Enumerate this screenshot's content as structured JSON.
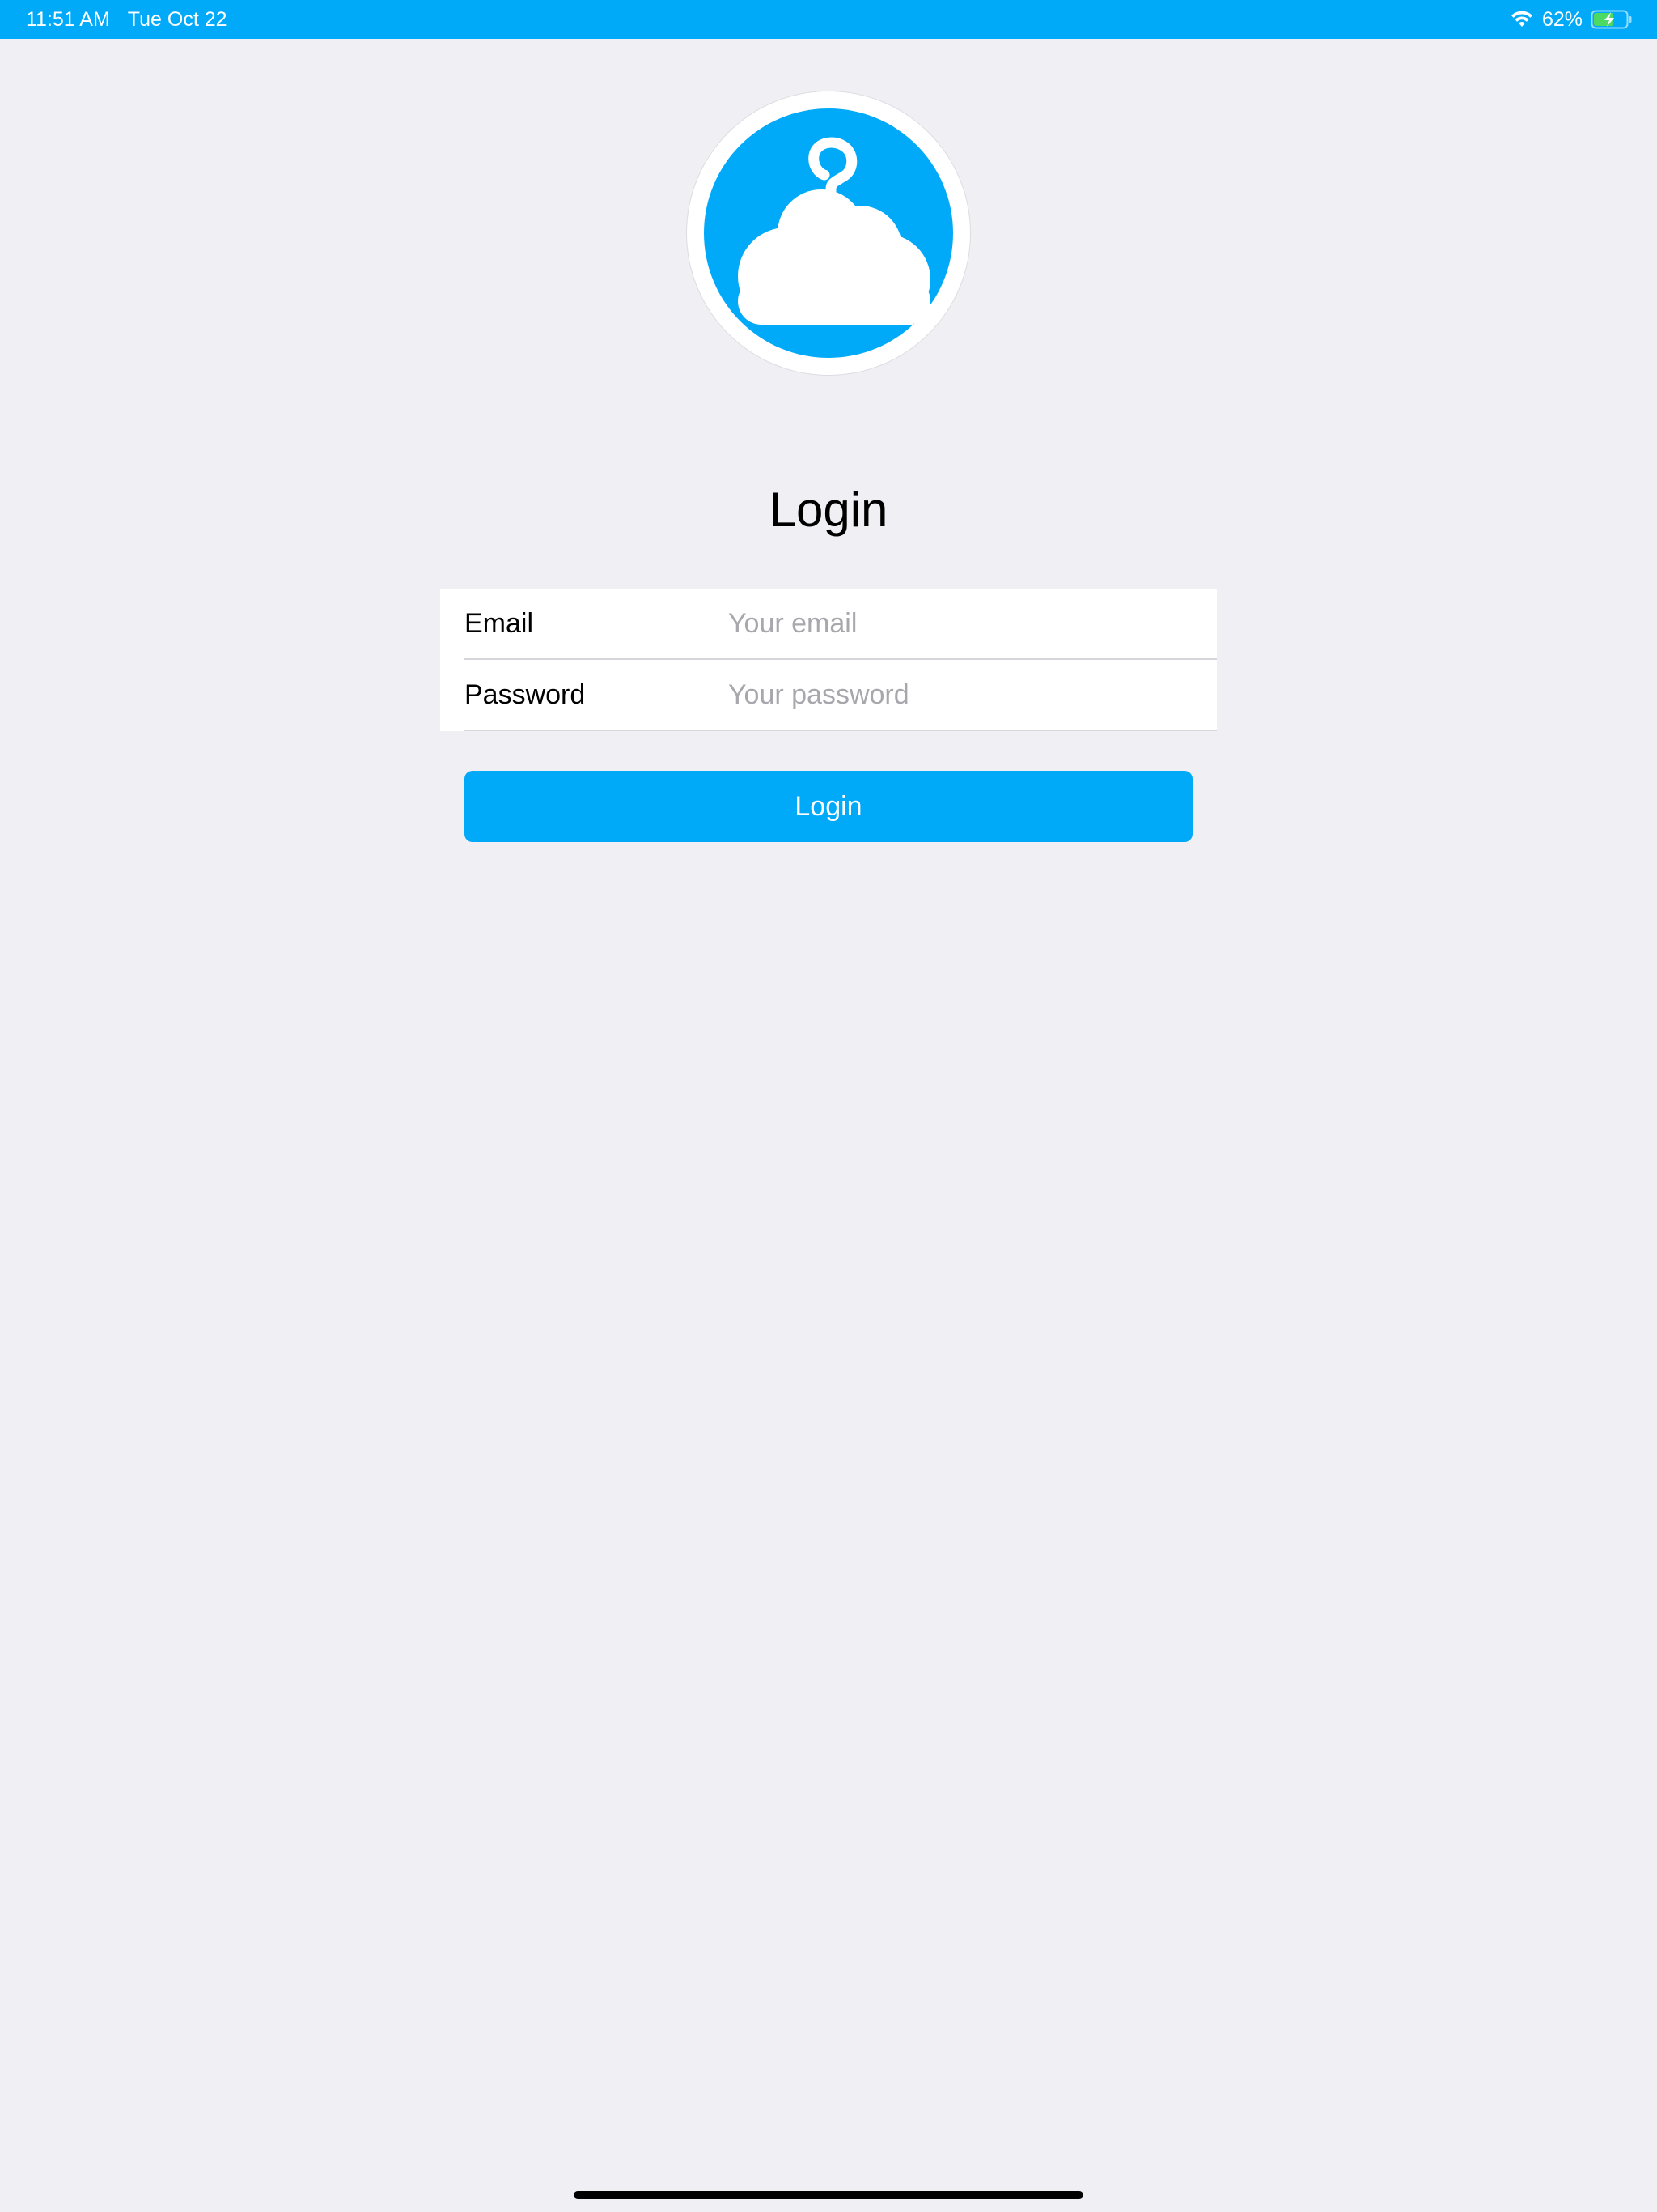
{
  "status_bar": {
    "time": "11:51 AM",
    "date": "Tue Oct 22",
    "battery_percent": "62%",
    "battery_level": 0.62,
    "wifi_icon": "wifi-icon",
    "battery_icon": "battery-charging-icon"
  },
  "logo": {
    "icon": "cloud-hanger-icon"
  },
  "page": {
    "title": "Login"
  },
  "form": {
    "email": {
      "label": "Email",
      "placeholder": "Your email",
      "value": ""
    },
    "password": {
      "label": "Password",
      "placeholder": "Your password",
      "value": ""
    }
  },
  "login_button": {
    "label": "Login"
  },
  "colors": {
    "accent": "#00aaf9",
    "background": "#efeff4",
    "placeholder": "#a7a7ad",
    "battery_fill": "#4cd964"
  }
}
